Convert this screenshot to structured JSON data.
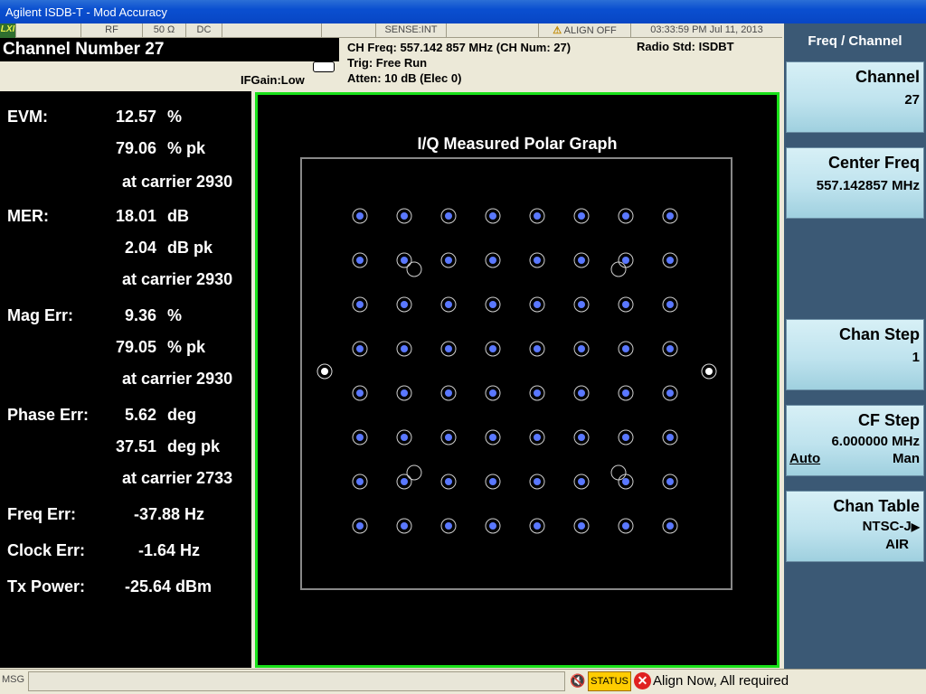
{
  "window": {
    "title": "Agilent ISDB-T - Mod Accuracy"
  },
  "infobar": {
    "lxi": "LXI",
    "rf": "RF",
    "impedance": "50 Ω",
    "coupling": "DC",
    "sense": "SENSE:INT",
    "align": "ALIGN OFF",
    "datetime": "03:33:59 PM Jul 11, 2013"
  },
  "header": {
    "channel_title": "Channel Number 27",
    "ifgain": "IFGain:Low",
    "ch_freq": "CH Freq: 557.142 857 MHz (CH Num: 27)",
    "trig": "Trig: Free Run",
    "atten": "Atten: 10 dB (Elec 0)",
    "radio_std": "Radio Std: ISDBT"
  },
  "results": {
    "evm": {
      "label": "EVM:",
      "value": "12.57",
      "unit": "%",
      "pk_value": "79.06",
      "pk_unit": "% pk",
      "carrier": "at carrier 2930"
    },
    "mer": {
      "label": "MER:",
      "value": "18.01",
      "unit": "dB",
      "pk_value": "2.04",
      "pk_unit": "dB pk",
      "carrier": "at carrier 2930"
    },
    "mag_err": {
      "label": "Mag Err:",
      "value": "9.36",
      "unit": "%",
      "pk_value": "79.05",
      "pk_unit": "% pk",
      "carrier": "at carrier 2930"
    },
    "phase_err": {
      "label": "Phase Err:",
      "value": "5.62",
      "unit": "deg",
      "pk_value": "37.51",
      "pk_unit": "deg pk",
      "carrier": "at carrier 2733"
    },
    "freq_err": {
      "label": "Freq Err:",
      "value": "-37.88 Hz"
    },
    "clock_err": {
      "label": "Clock Err:",
      "value": "-1.64 Hz"
    },
    "tx_power": {
      "label": "Tx Power:",
      "value": "-25.64 dBm"
    }
  },
  "graph": {
    "title": "I/Q Measured Polar Graph",
    "constellation": "64QAM",
    "symbol_color": "#5a78ff",
    "pilot_color": "#ffffff"
  },
  "softkeys": {
    "menu_title": "Freq / Channel",
    "channel": {
      "label": "Channel",
      "value": "27"
    },
    "center_freq": {
      "label": "Center Freq",
      "value": "557.142857 MHz"
    },
    "chan_step": {
      "label": "Chan Step",
      "value": "1"
    },
    "cf_step": {
      "label": "CF Step",
      "value": "6.000000 MHz",
      "auto": "Auto",
      "man": "Man"
    },
    "chan_table": {
      "label": "Chan Table",
      "value1": "NTSC-J",
      "value2": "AIR"
    }
  },
  "statusbar": {
    "msg_label": "MSG",
    "status_button": "STATUS",
    "alert_text": "Align Now, All required"
  }
}
